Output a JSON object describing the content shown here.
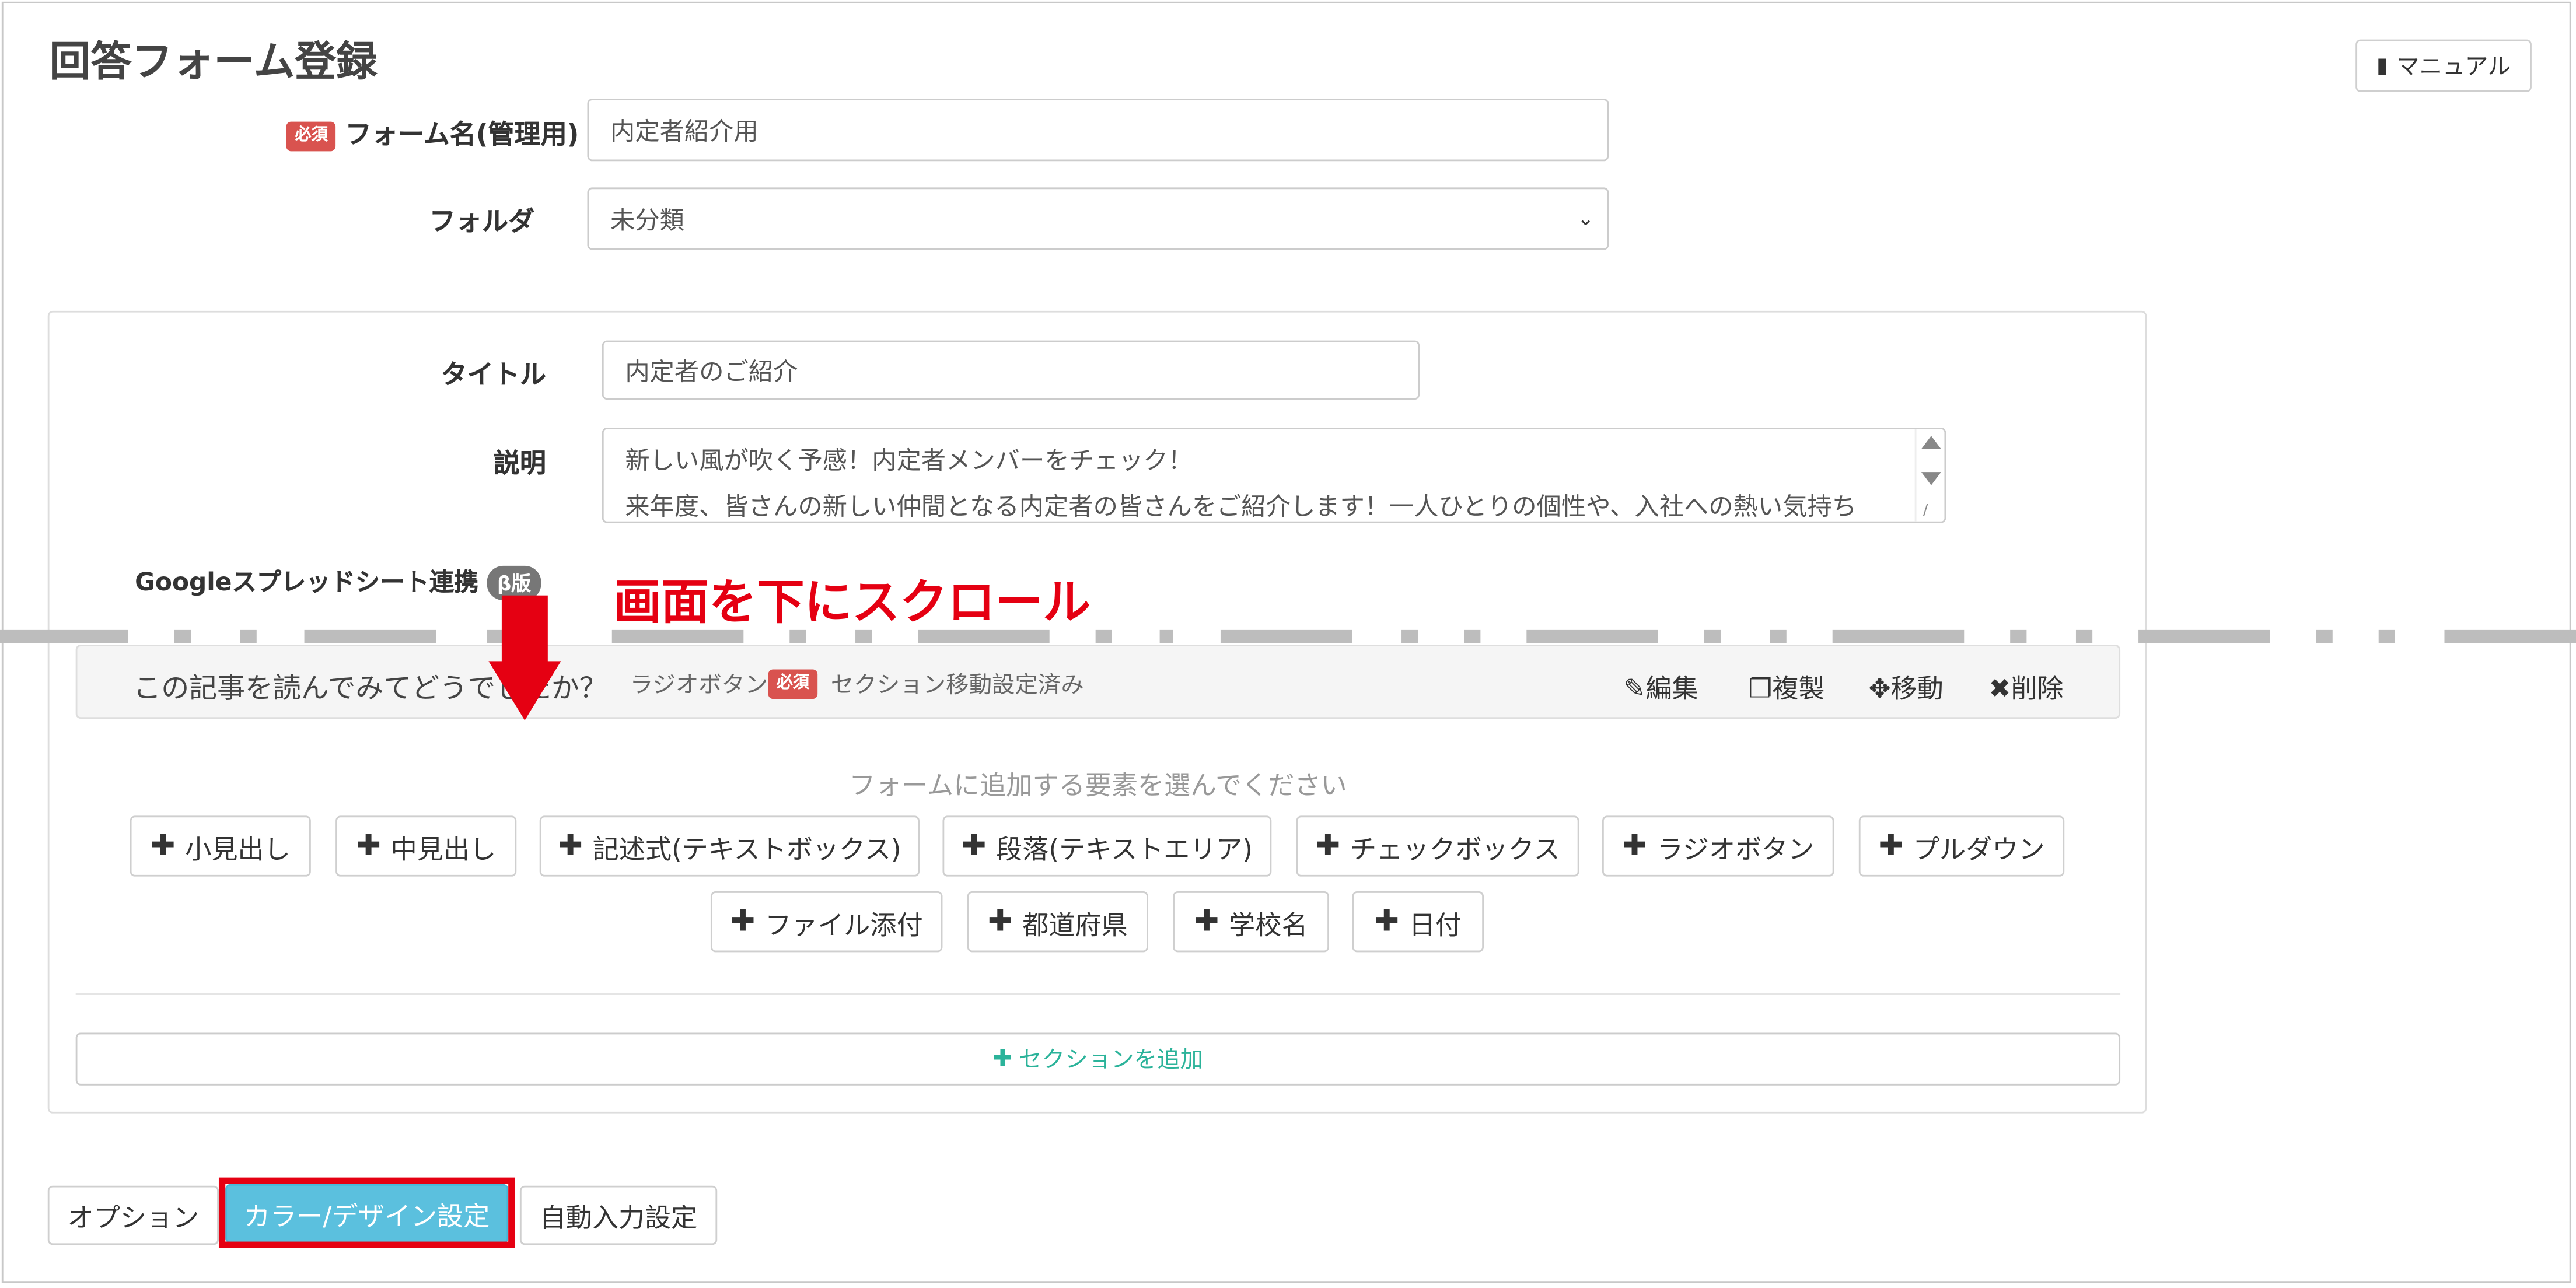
{
  "page_title": "回答フォーム登録",
  "manual_button": "マニュアル",
  "required_badge": "必須",
  "form_name": {
    "label": "フォーム名(管理用)",
    "value": "内定者紹介用"
  },
  "folder": {
    "label": "フォルダ",
    "value": "未分類"
  },
  "title_field": {
    "label": "タイトル",
    "value": "内定者のご紹介"
  },
  "description": {
    "label": "説明",
    "line1": "新しい風が吹く予感！内定者メンバーをチェック！",
    "line2": "来年度、皆さんの新しい仲間となる内定者の皆さんをご紹介します！一人ひとりの個性や、入社への熱い気持ち"
  },
  "google_sheets": {
    "label": "Googleスプレッドシート連携",
    "beta": "β版"
  },
  "annotation": "画面を下にスクロール",
  "question": {
    "text": "この記事を読んでみてどうでしたか？",
    "type": "ラジオボタン",
    "section_note": "セクション移動設定済み",
    "actions": {
      "edit": "編集",
      "copy": "複製",
      "move": "移動",
      "delete": "削除"
    }
  },
  "add_element_hint": "フォームに追加する要素を選んでください",
  "elements_row1": [
    "小見出し",
    "中見出し",
    "記述式(テキストボックス)",
    "段落(テキストエリア)",
    "チェックボックス",
    "ラジオボタン",
    "プルダウン"
  ],
  "elements_row2": [
    "ファイル添付",
    "都道府県",
    "学校名",
    "日付"
  ],
  "add_section": "セクションを追加",
  "bottom_tabs": {
    "options": "オプション",
    "color_design": "カラー/デザイン設定",
    "auto_input": "自動入力設定"
  },
  "colors": {
    "annotation_red": "#e50012",
    "active_tab": "#5bc0de",
    "add_section_teal": "#2bb39a",
    "required_red": "#d9534f"
  }
}
